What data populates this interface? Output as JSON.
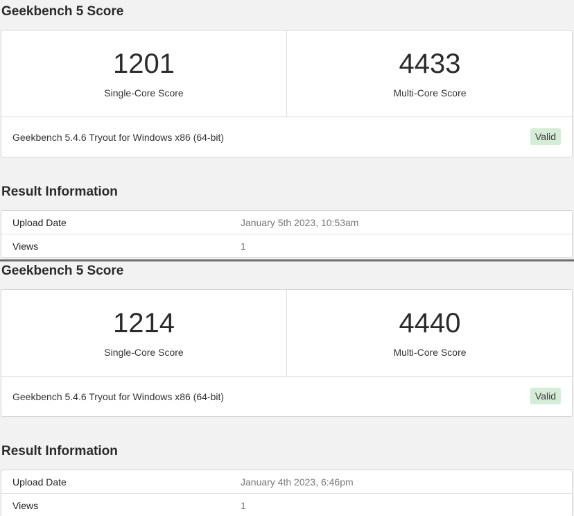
{
  "results": [
    {
      "score_heading": "Geekbench 5 Score",
      "single_core": {
        "value": "1201",
        "label": "Single-Core Score"
      },
      "multi_core": {
        "value": "4433",
        "label": "Multi-Core Score"
      },
      "version": "Geekbench 5.4.6 Tryout for Windows x86 (64-bit)",
      "status": "Valid",
      "info_heading": "Result Information",
      "info": [
        {
          "key": "Upload Date",
          "value": "January 5th 2023, 10:53am"
        },
        {
          "key": "Views",
          "value": "1"
        }
      ]
    },
    {
      "score_heading": "Geekbench 5 Score",
      "single_core": {
        "value": "1214",
        "label": "Single-Core Score"
      },
      "multi_core": {
        "value": "4440",
        "label": "Multi-Core Score"
      },
      "version": "Geekbench 5.4.6 Tryout for Windows x86 (64-bit)",
      "status": "Valid",
      "info_heading": "Result Information",
      "info": [
        {
          "key": "Upload Date",
          "value": "January 4th 2023, 6:46pm"
        },
        {
          "key": "Views",
          "value": "1"
        }
      ]
    }
  ],
  "colors": {
    "background": "#f2f2f2",
    "valid_badge": "#d5ecd7",
    "divider": "#6e6e6e"
  }
}
